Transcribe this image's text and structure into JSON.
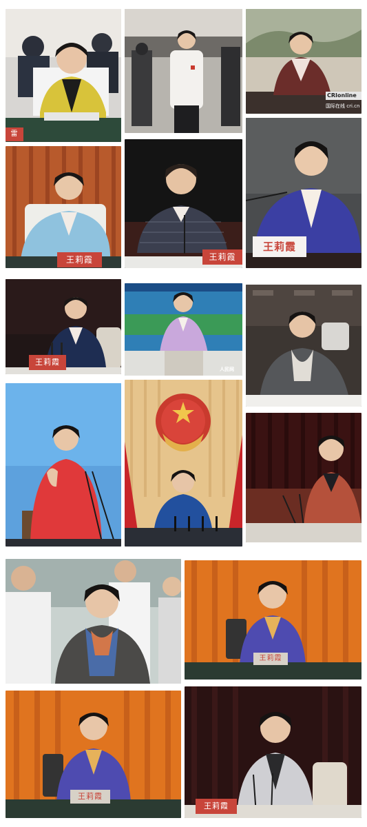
{
  "collage": {
    "nameplates": {
      "r1c1": "雷",
      "r2c1": "王莉霞",
      "r2c2": "王莉霞",
      "r2c3": "王莉霞",
      "r3c1": "王莉霞",
      "r5c2": "王莉霞",
      "r6c1": "王莉霞",
      "r6c2": "王莉霞"
    },
    "watermarks": {
      "cri_logo": "CRIonline",
      "cri_caption": "国际在线 cri.cn",
      "people_logo": "人民网"
    }
  }
}
